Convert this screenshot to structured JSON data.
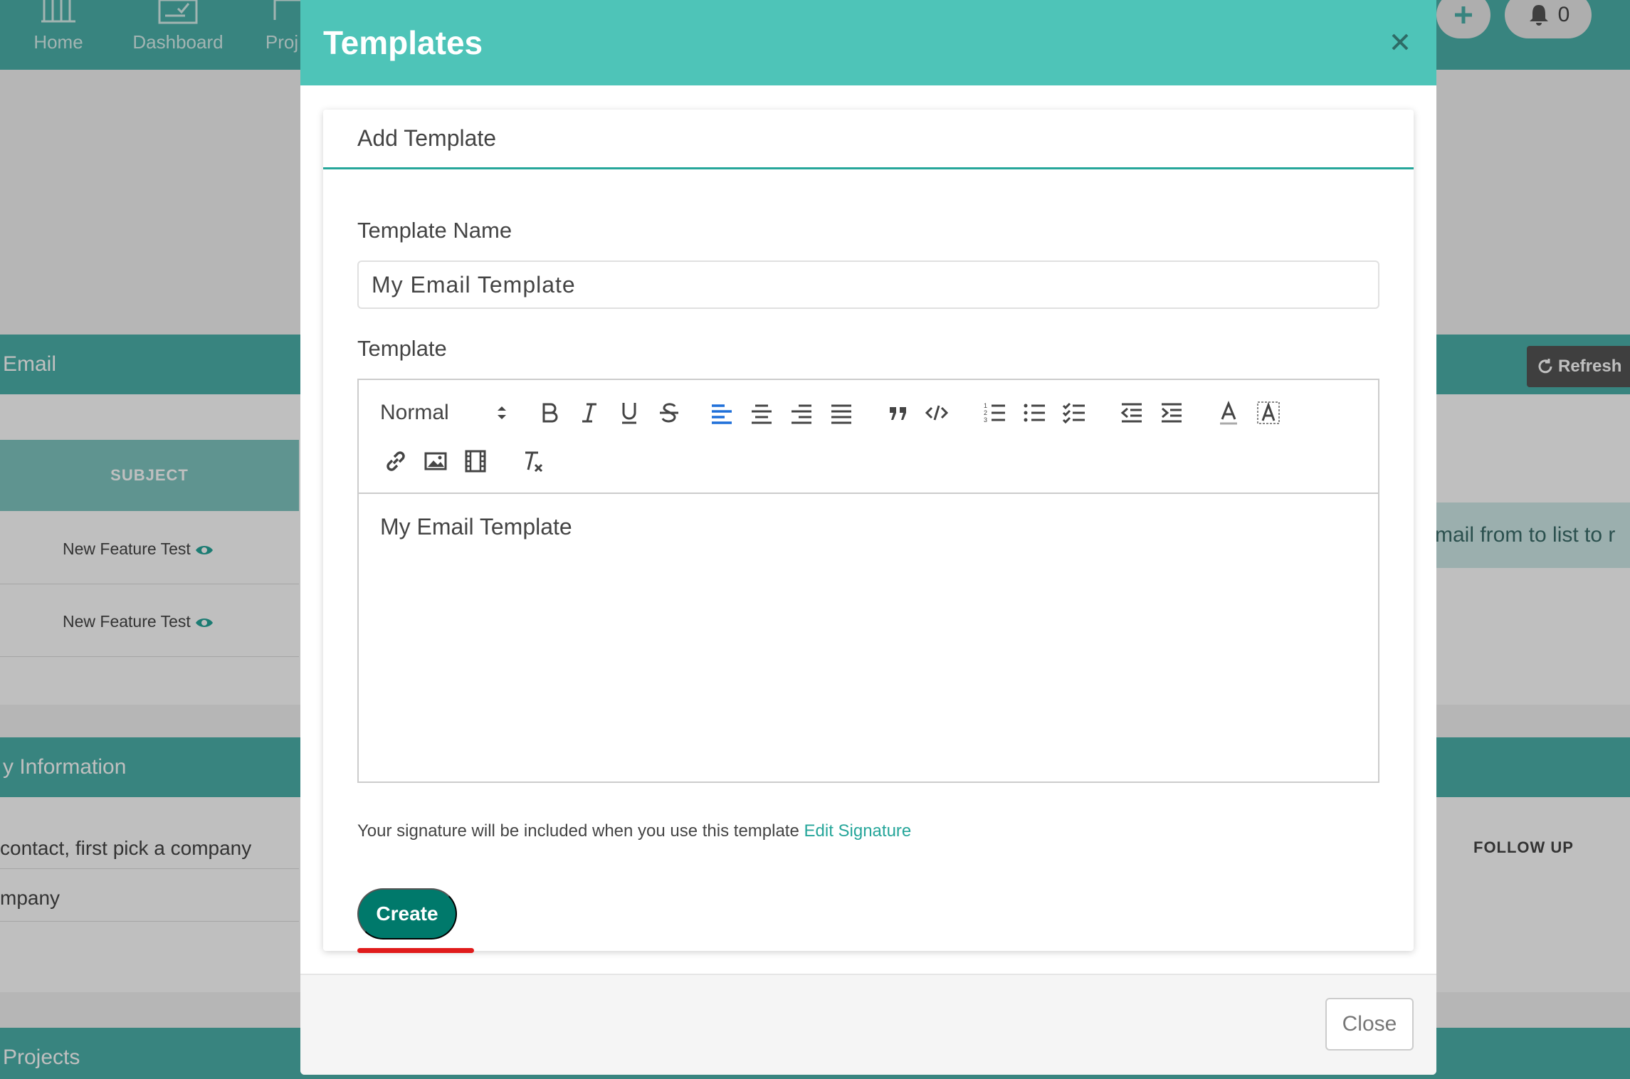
{
  "nav": {
    "items": [
      {
        "label": "Home",
        "icon": "bar-chart-icon"
      },
      {
        "label": "Dashboard",
        "icon": "checklist-icon"
      },
      {
        "label": "Proj",
        "icon": "folder-icon"
      }
    ],
    "notifications_count": "0"
  },
  "background": {
    "email_section_title": "Email",
    "refresh_label": "Refresh",
    "subject_header": "SUBJECT",
    "rows": [
      "New Feature Test",
      "New Feature Test"
    ],
    "callout_text": "mail from to list to r",
    "info_section_title": "y Information",
    "info_row_1": "contact, first pick a company",
    "info_row_2": "mpany",
    "follow_up_header": "FOLLOW UP",
    "projects_section_title": "Projects"
  },
  "modal": {
    "title": "Templates",
    "card_title": "Add Template",
    "name_label": "Template Name",
    "name_value": "My Email Template",
    "template_label": "Template",
    "format_select": "Normal",
    "editor_content": "My Email Template",
    "signature_text": "Your signature will be included when you use this template",
    "signature_link": "Edit Signature",
    "create_label": "Create",
    "close_label": "Close"
  },
  "colors": {
    "header_teal": "#4ec4b8",
    "app_teal": "#4bb1aa",
    "create_button": "#00796b",
    "link": "#26a69a",
    "annotation_red": "#e01b1b",
    "active_align": "#1e6fd9"
  }
}
